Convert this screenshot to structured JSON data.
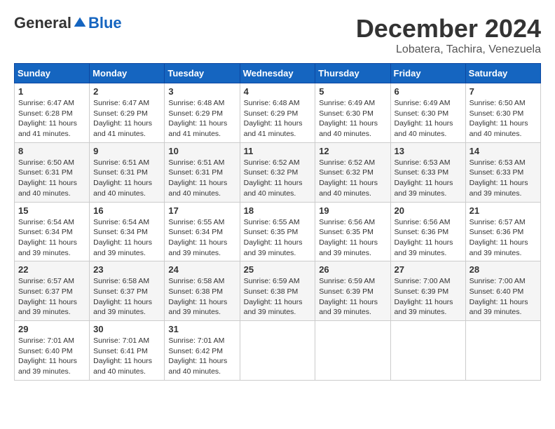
{
  "logo": {
    "general": "General",
    "blue": "Blue"
  },
  "header": {
    "month": "December 2024",
    "location": "Lobatera, Tachira, Venezuela"
  },
  "days_of_week": [
    "Sunday",
    "Monday",
    "Tuesday",
    "Wednesday",
    "Thursday",
    "Friday",
    "Saturday"
  ],
  "weeks": [
    [
      {
        "day": "1",
        "sunrise": "6:47 AM",
        "sunset": "6:28 PM",
        "daylight": "11 hours and 41 minutes."
      },
      {
        "day": "2",
        "sunrise": "6:47 AM",
        "sunset": "6:29 PM",
        "daylight": "11 hours and 41 minutes."
      },
      {
        "day": "3",
        "sunrise": "6:48 AM",
        "sunset": "6:29 PM",
        "daylight": "11 hours and 41 minutes."
      },
      {
        "day": "4",
        "sunrise": "6:48 AM",
        "sunset": "6:29 PM",
        "daylight": "11 hours and 41 minutes."
      },
      {
        "day": "5",
        "sunrise": "6:49 AM",
        "sunset": "6:30 PM",
        "daylight": "11 hours and 40 minutes."
      },
      {
        "day": "6",
        "sunrise": "6:49 AM",
        "sunset": "6:30 PM",
        "daylight": "11 hours and 40 minutes."
      },
      {
        "day": "7",
        "sunrise": "6:50 AM",
        "sunset": "6:30 PM",
        "daylight": "11 hours and 40 minutes."
      }
    ],
    [
      {
        "day": "8",
        "sunrise": "6:50 AM",
        "sunset": "6:31 PM",
        "daylight": "11 hours and 40 minutes."
      },
      {
        "day": "9",
        "sunrise": "6:51 AM",
        "sunset": "6:31 PM",
        "daylight": "11 hours and 40 minutes."
      },
      {
        "day": "10",
        "sunrise": "6:51 AM",
        "sunset": "6:31 PM",
        "daylight": "11 hours and 40 minutes."
      },
      {
        "day": "11",
        "sunrise": "6:52 AM",
        "sunset": "6:32 PM",
        "daylight": "11 hours and 40 minutes."
      },
      {
        "day": "12",
        "sunrise": "6:52 AM",
        "sunset": "6:32 PM",
        "daylight": "11 hours and 40 minutes."
      },
      {
        "day": "13",
        "sunrise": "6:53 AM",
        "sunset": "6:33 PM",
        "daylight": "11 hours and 39 minutes."
      },
      {
        "day": "14",
        "sunrise": "6:53 AM",
        "sunset": "6:33 PM",
        "daylight": "11 hours and 39 minutes."
      }
    ],
    [
      {
        "day": "15",
        "sunrise": "6:54 AM",
        "sunset": "6:34 PM",
        "daylight": "11 hours and 39 minutes."
      },
      {
        "day": "16",
        "sunrise": "6:54 AM",
        "sunset": "6:34 PM",
        "daylight": "11 hours and 39 minutes."
      },
      {
        "day": "17",
        "sunrise": "6:55 AM",
        "sunset": "6:34 PM",
        "daylight": "11 hours and 39 minutes."
      },
      {
        "day": "18",
        "sunrise": "6:55 AM",
        "sunset": "6:35 PM",
        "daylight": "11 hours and 39 minutes."
      },
      {
        "day": "19",
        "sunrise": "6:56 AM",
        "sunset": "6:35 PM",
        "daylight": "11 hours and 39 minutes."
      },
      {
        "day": "20",
        "sunrise": "6:56 AM",
        "sunset": "6:36 PM",
        "daylight": "11 hours and 39 minutes."
      },
      {
        "day": "21",
        "sunrise": "6:57 AM",
        "sunset": "6:36 PM",
        "daylight": "11 hours and 39 minutes."
      }
    ],
    [
      {
        "day": "22",
        "sunrise": "6:57 AM",
        "sunset": "6:37 PM",
        "daylight": "11 hours and 39 minutes."
      },
      {
        "day": "23",
        "sunrise": "6:58 AM",
        "sunset": "6:37 PM",
        "daylight": "11 hours and 39 minutes."
      },
      {
        "day": "24",
        "sunrise": "6:58 AM",
        "sunset": "6:38 PM",
        "daylight": "11 hours and 39 minutes."
      },
      {
        "day": "25",
        "sunrise": "6:59 AM",
        "sunset": "6:38 PM",
        "daylight": "11 hours and 39 minutes."
      },
      {
        "day": "26",
        "sunrise": "6:59 AM",
        "sunset": "6:39 PM",
        "daylight": "11 hours and 39 minutes."
      },
      {
        "day": "27",
        "sunrise": "7:00 AM",
        "sunset": "6:39 PM",
        "daylight": "11 hours and 39 minutes."
      },
      {
        "day": "28",
        "sunrise": "7:00 AM",
        "sunset": "6:40 PM",
        "daylight": "11 hours and 39 minutes."
      }
    ],
    [
      {
        "day": "29",
        "sunrise": "7:01 AM",
        "sunset": "6:40 PM",
        "daylight": "11 hours and 39 minutes."
      },
      {
        "day": "30",
        "sunrise": "7:01 AM",
        "sunset": "6:41 PM",
        "daylight": "11 hours and 40 minutes."
      },
      {
        "day": "31",
        "sunrise": "7:01 AM",
        "sunset": "6:42 PM",
        "daylight": "11 hours and 40 minutes."
      },
      null,
      null,
      null,
      null
    ]
  ]
}
